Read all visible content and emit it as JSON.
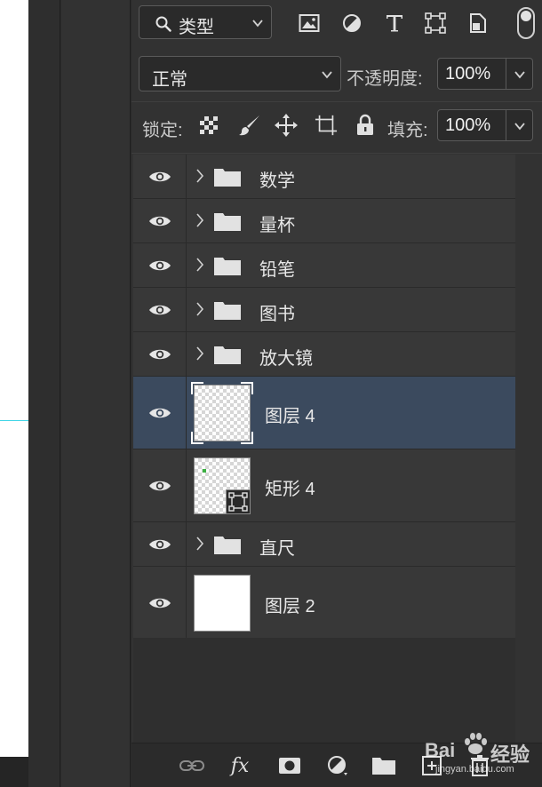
{
  "filter": {
    "kind_label": "类型",
    "icons": [
      "image-filter-icon",
      "adjustment-filter-icon",
      "type-filter-icon",
      "shape-filter-icon",
      "smart-object-filter-icon"
    ]
  },
  "blend": {
    "mode": "正常",
    "opacity_label": "不透明度:",
    "opacity_value": "100%"
  },
  "lock": {
    "label": "锁定:",
    "fill_label": "填充:",
    "fill_value": "100%"
  },
  "layers": [
    {
      "name": "数学",
      "type": "group"
    },
    {
      "name": "量杯",
      "type": "group"
    },
    {
      "name": "铅笔",
      "type": "group"
    },
    {
      "name": "图书",
      "type": "group"
    },
    {
      "name": "放大镜",
      "type": "group"
    },
    {
      "name": "图层 4",
      "type": "pixel",
      "selected": true
    },
    {
      "name": "矩形 4",
      "type": "shape"
    },
    {
      "name": "直尺",
      "type": "group"
    },
    {
      "name": "图层 2",
      "type": "pixel-white"
    }
  ],
  "footer": {
    "fx_label": "fx"
  },
  "watermark": {
    "brand": "Bai",
    "brand2": "经验",
    "url": "jingyan.baidu.com"
  },
  "colors": {
    "panel_bg": "#323232",
    "selected_row": "#3b4a5e",
    "guide": "#3fd5e6"
  }
}
